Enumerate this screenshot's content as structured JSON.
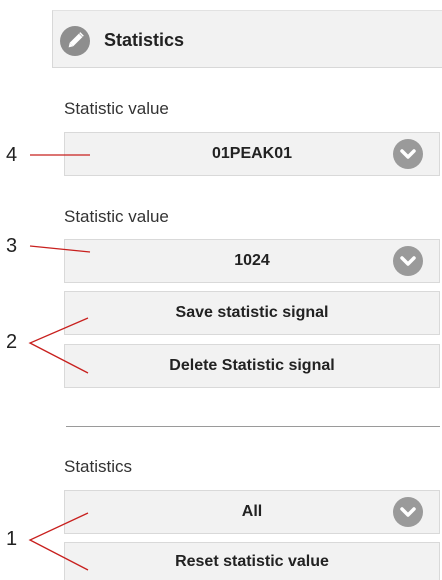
{
  "header": {
    "title": "Statistics",
    "icon": "pencil-icon"
  },
  "section1": {
    "label": "Statistic value",
    "dropdown_value": "01PEAK01",
    "callout": "4"
  },
  "section2": {
    "label": "Statistic value",
    "dropdown_value": "1024",
    "callout": "3",
    "save_button": "Save statistic signal",
    "delete_button": "Delete Statistic signal",
    "buttons_callout": "2"
  },
  "section3": {
    "label": "Statistics",
    "dropdown_value": "All",
    "reset_button": "Reset statistic value",
    "callout": "1"
  },
  "colors": {
    "panel": "#f2f2f2",
    "border": "#d9d9d9",
    "icon": "#9a9a9a"
  }
}
